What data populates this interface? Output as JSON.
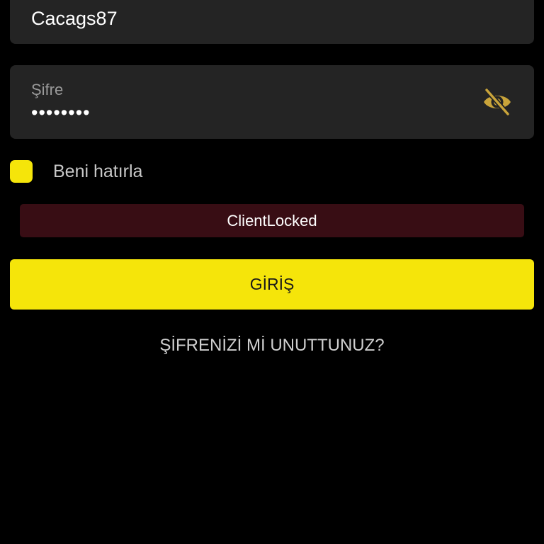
{
  "login_form": {
    "username": {
      "value": "Cacags87"
    },
    "password": {
      "label": "Şifre",
      "value": "••••••••",
      "visibility_icon": "eye-slash-icon"
    },
    "remember_me": {
      "label": "Beni hatırla",
      "checked": true
    },
    "error_message": "ClientLocked",
    "submit_label": "GİRİŞ",
    "forgot_password_label": "ŞİFRENİZİ Mİ UNUTTUNUZ?"
  },
  "colors": {
    "background": "#000000",
    "field_background": "#242424",
    "accent": "#f5e50a",
    "error_background": "#380d14",
    "icon_gold": "#c9a43a"
  }
}
